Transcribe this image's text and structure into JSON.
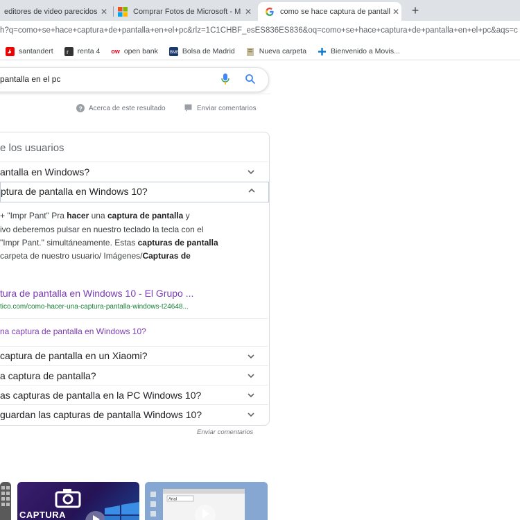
{
  "tabs": [
    {
      "title": "editores de video parecidos a",
      "close": "✕",
      "active": false
    },
    {
      "title": "Comprar Fotos de Microsoft - M",
      "close": "✕",
      "active": false
    },
    {
      "title": "como se hace captura de pantalla",
      "close": "✕",
      "active": true
    }
  ],
  "new_tab": "+",
  "address_bar": {
    "url": "h?q=como+se+hace+captura+de+pantalla+en+el+pc&rlz=1C1CHBF_esES836ES836&oq=como+se+hace+captura+de+pantalla+en+el+pc&aqs=c"
  },
  "bookmarks": [
    {
      "label": "santandert",
      "icon": "santander-icon",
      "color": "#ec0000"
    },
    {
      "label": "renta 4",
      "icon": "renta4-icon",
      "color": "#333333"
    },
    {
      "label": "open bank",
      "icon": "openbank-icon",
      "prefix": "ow",
      "color": "#e2001a"
    },
    {
      "label": "Bolsa de Madrid",
      "icon": "bolsa-icon",
      "color": "#1a3a6b"
    },
    {
      "label": "Nueva carpeta",
      "icon": "folder-icon",
      "color": "#c8c0a0"
    },
    {
      "label": "Bienvenido a Movis...",
      "icon": "movistar-icon",
      "color": "#0b78d0"
    }
  ],
  "search": {
    "query": "pantalla en el pc"
  },
  "result_footer": {
    "about": "Acerca de este resultado",
    "feedback": "Enviar comentarios"
  },
  "people_also_ask": {
    "heading": "e los usuarios",
    "questions": [
      {
        "text": "antalla en Windows?",
        "expanded": false
      },
      {
        "text": "ptura de pantalla en Windows 10?",
        "expanded": true
      }
    ],
    "answer": {
      "line1_a": " + \"Impr Pant\" Pra ",
      "line1_b": "hacer",
      "line1_c": " una ",
      "line1_d": "captura de pantalla",
      "line1_e": " y",
      "line2": "ivo deberemos pulsar en nuestro teclado la tecla con el",
      "line3_a": "\"Impr Pant.\" simultáneamente. Estas ",
      "line3_b": "capturas de pantalla",
      "line4_a": "carpeta de nuestro usuario/ Imágenes/",
      "line4_b": "Capturas de"
    },
    "result_title": "tura de pantalla en Windows 10 - El Grupo ...",
    "result_url": "tico.com/como-hacer-una-captura-pantalla-windows-t24648...",
    "search_more": "na captura de pantalla en Windows 10?",
    "more_questions": [
      "captura de pantalla en un Xiaomi?",
      "a captura de pantalla?",
      "as capturas de pantalla en la PC Windows 10?",
      " guardan las capturas de pantalla Windows 10?"
    ],
    "feedback": "Enviar comentarios"
  },
  "videos": [
    {
      "caption": "CAPTURA"
    }
  ],
  "colors": {
    "link_visited": "#7a3ab1",
    "url_green": "#188038",
    "tabbar": "#dee1e6"
  }
}
